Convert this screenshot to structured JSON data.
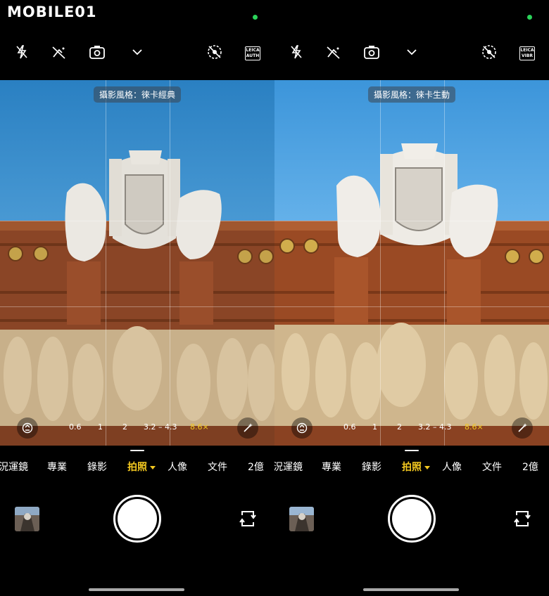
{
  "watermark": {
    "brand": "MOBILE01"
  },
  "panels": [
    {
      "top_icons": [
        "flash-off-icon",
        "ai-off-icon",
        "lens-capture-icon",
        "chevron-down-icon",
        "motion-photo-off-icon"
      ],
      "leica_badge": {
        "line1": "LEICA",
        "line2": "AUTH"
      },
      "style_label": "攝影風格：徠卡經典",
      "sky_color": "#3d8fc8",
      "zoom": {
        "options": [
          "0.6",
          "1",
          "2",
          "3.2 – 4.3",
          "8.6×"
        ],
        "active": "8.6×"
      },
      "modes": [
        "況運鏡",
        "專業",
        "錄影",
        "拍照",
        "人像",
        "文件",
        "2億"
      ],
      "active_mode": "拍照"
    },
    {
      "top_icons": [
        "flash-off-icon",
        "ai-off-icon",
        "lens-capture-icon",
        "chevron-down-icon",
        "motion-photo-off-icon"
      ],
      "leica_badge": {
        "line1": "LEICA",
        "line2": "VIBR"
      },
      "style_label": "攝影風格：徠卡生動",
      "sky_color": "#4a9fe0",
      "zoom": {
        "options": [
          "0.6",
          "1",
          "2",
          "3.2 – 4.3",
          "8.6×"
        ],
        "active": "8.6×"
      },
      "modes": [
        "況運鏡",
        "專業",
        "錄影",
        "拍照",
        "人像",
        "文件",
        "2億"
      ],
      "active_mode": "拍照"
    }
  ],
  "colors": {
    "accent": "#f3c820",
    "status_dot": "#2bd35a",
    "brick": "#8c4a2a",
    "relief": "#c9b28c"
  }
}
